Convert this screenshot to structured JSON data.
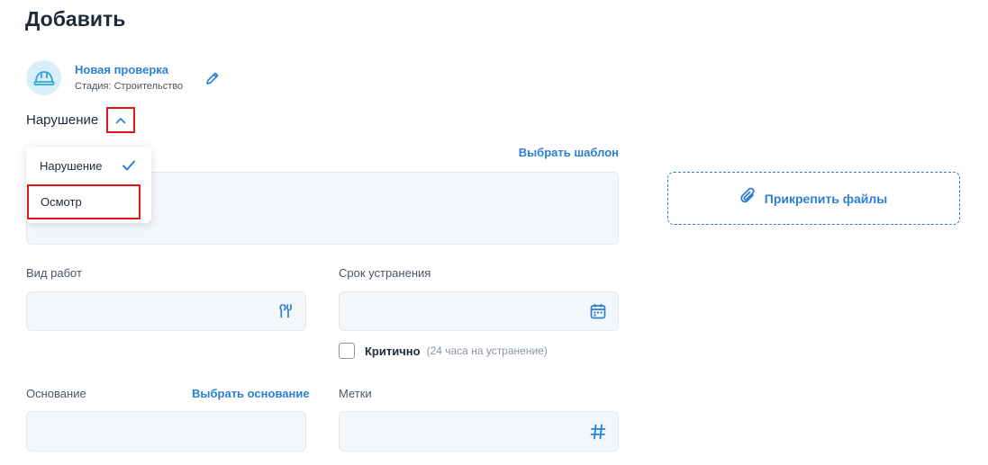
{
  "page": {
    "title": "Добавить"
  },
  "inspection": {
    "name": "Новая проверка",
    "stage": "Стадия: Строительство",
    "icon": "helmet-icon",
    "edit_icon": "pencil-icon"
  },
  "type_selector": {
    "label": "Нарушение",
    "toggle_icon": "chevron-up-icon",
    "options": [
      {
        "label": "Нарушение",
        "checked": true
      },
      {
        "label": "Осмотр",
        "checked": false
      }
    ]
  },
  "description": {
    "template_link": "Выбрать шаблон",
    "value": ""
  },
  "attach": {
    "label": "Прикрепить файлы",
    "icon": "paperclip-icon"
  },
  "work_type": {
    "label": "Вид работ",
    "value": "",
    "icon": "wrench-icon"
  },
  "deadline": {
    "label": "Срок устранения",
    "value": "",
    "icon": "calendar-icon"
  },
  "critical": {
    "label": "Критично",
    "hint": "(24 часа на устранение)",
    "checked": false
  },
  "basis": {
    "label": "Основание",
    "link": "Выбрать основание",
    "value": ""
  },
  "tags": {
    "label": "Метки",
    "value": "",
    "icon": "hash-icon"
  },
  "colors": {
    "accent": "#2b7fd4",
    "highlight": "#e0161b",
    "field_bg": "#f4f7fa",
    "avatar_bg": "#d8eef8"
  }
}
